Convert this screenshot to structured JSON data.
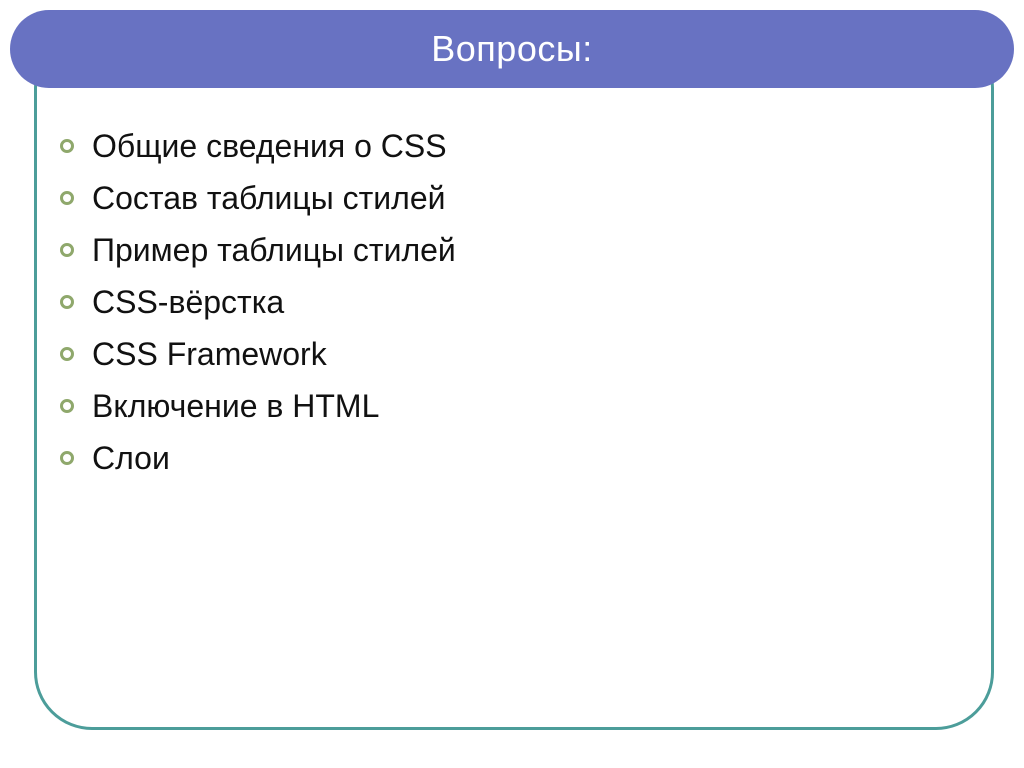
{
  "title": "Вопросы:",
  "items": [
    "Общие сведения о CSS",
    "Состав таблицы стилей",
    "Пример таблицы стилей",
    "CSS-вёрстка",
    "CSS Framework",
    "Включение в HTML",
    "Слои"
  ],
  "colors": {
    "accent": "#6872C2",
    "panel_border": "#4C9D9A",
    "bullet_ring": "#8FA86C"
  }
}
